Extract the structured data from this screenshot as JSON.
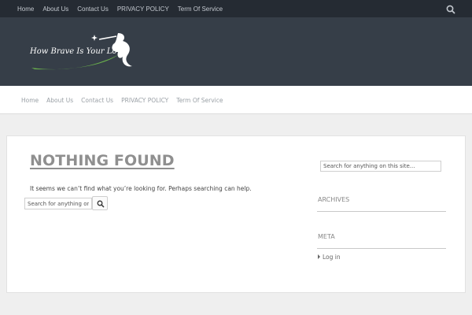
{
  "top_nav": {
    "items": [
      "Home",
      "About Us",
      "Contact Us",
      "PRIVACY POLICY",
      "Term Of Service"
    ],
    "search_icon": "search-icon"
  },
  "header": {
    "logo_text": "How Brave Is Your Love",
    "colors": {
      "header_bg": "#363e48",
      "topbar_bg": "#252b33",
      "logo_swoosh": "#6ab04c"
    }
  },
  "main_nav": {
    "items": [
      "Home",
      "About Us",
      "Contact Us",
      "PRIVACY POLICY",
      "Term Of Service"
    ]
  },
  "main": {
    "title": "NOTHING FOUND",
    "message": "It seems we can’t find what you’re looking for. Perhaps searching can help.",
    "search_placeholder": "Search for anything on this site...",
    "search_button_icon": "search-icon"
  },
  "sidebar": {
    "search_placeholder": "Search for anything on this site...",
    "archives_title": "ARCHIVES",
    "meta_title": "META",
    "meta_items": [
      "Log in"
    ]
  }
}
